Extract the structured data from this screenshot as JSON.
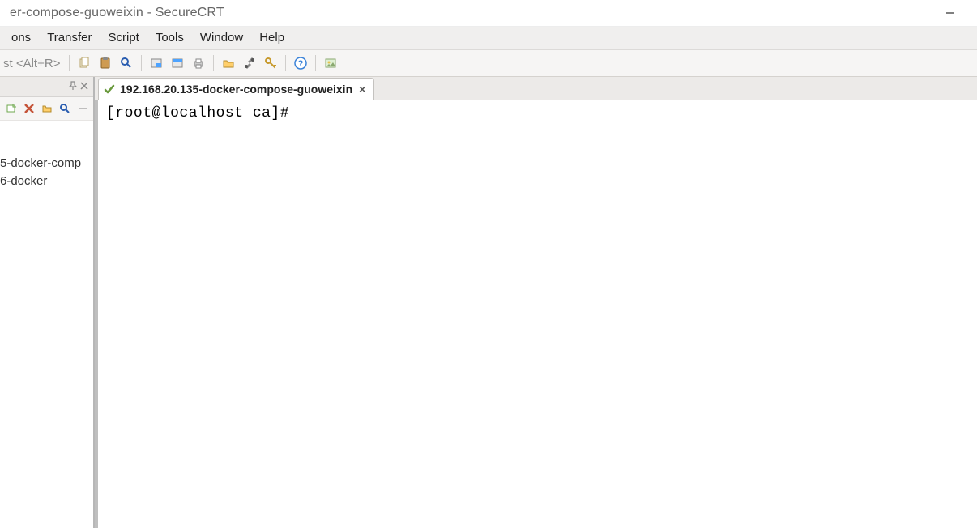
{
  "window": {
    "title": "er-compose-guoweixin - SecureCRT"
  },
  "menu": {
    "items": [
      "ons",
      "Transfer",
      "Script",
      "Tools",
      "Window",
      "Help"
    ]
  },
  "toolbar": {
    "hint": "st <Alt+R>"
  },
  "sidebar": {
    "sessions": [
      "5-docker-comp",
      "6-docker"
    ]
  },
  "tabs": {
    "active": {
      "label": "192.168.20.135-docker-compose-guoweixin"
    }
  },
  "terminal": {
    "prompt": "[root@localhost ca]#"
  }
}
